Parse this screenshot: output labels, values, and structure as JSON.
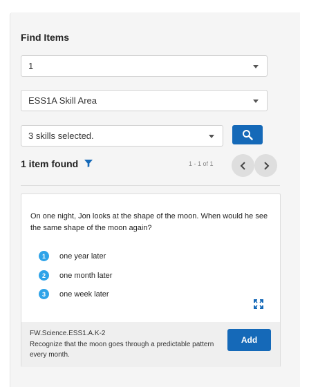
{
  "filters": {
    "heading": "Find Items",
    "grade": {
      "value": "1"
    },
    "skill_area": {
      "value": "ESS1A Skill Area"
    },
    "skills": {
      "value": "3 skills selected."
    },
    "search_icon": "magnifier-icon"
  },
  "results": {
    "count_label": "1 item found",
    "filter_icon": "funnel-icon",
    "range_label": "1 - 1 of 1"
  },
  "item": {
    "question": "On one night, Jon looks at the shape of the moon. When would he see the same shape of the moon again?",
    "answers": [
      {
        "number": "1",
        "text": "one year later"
      },
      {
        "number": "2",
        "text": "one month later"
      },
      {
        "number": "3",
        "text": "one week later"
      }
    ],
    "standard_code": "FW.Science.ESS1.A.K-2",
    "standard_description": "Recognize that the moon goes through a predictable pattern every month.",
    "add_label": "Add"
  },
  "colors": {
    "primary": "#1569b8",
    "answer_badge": "#2ea3e8",
    "panel_bg": "#f5f5f5"
  }
}
